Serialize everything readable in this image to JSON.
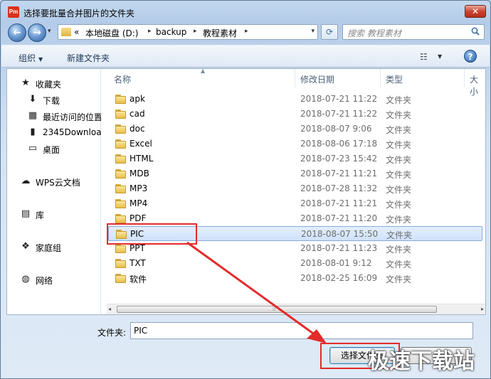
{
  "window": {
    "title": "选择要批量合并图片的文件夹",
    "app_icon_text": "Pm",
    "close_label": "✕"
  },
  "navbar": {
    "back_label": "←",
    "forward_label": "→",
    "history_arrow": "▾",
    "breadcrumb": {
      "overflow": "«",
      "segments": [
        "本地磁盘 (D:)",
        "backup",
        "教程素材"
      ],
      "separator": "▸",
      "dropdown": "▾"
    },
    "refresh_label": "⟳",
    "search_placeholder": "搜索 教程素材"
  },
  "toolbar": {
    "organize_label": "组织",
    "organize_drop": "▼",
    "new_folder_label": "新建文件夹",
    "view_icon": "☷",
    "view_drop": "▼",
    "help_label": "?"
  },
  "sidebar": {
    "items": [
      {
        "label": "收藏夹",
        "icon": "star-icon",
        "glyph": "★",
        "color": "#e8b21a"
      },
      {
        "label": "下载",
        "icon": "download-folder-icon",
        "glyph": "⬇",
        "color": "#3b78c4"
      },
      {
        "label": "最近访问的位置",
        "icon": "recent-places-icon",
        "glyph": "▦",
        "color": "#6b7d93"
      },
      {
        "label": "2345Downloads",
        "icon": "folder-icon",
        "glyph": "▮",
        "color": "#e1b545"
      },
      {
        "label": "桌面",
        "icon": "desktop-icon",
        "glyph": "▭",
        "color": "#2d6ab8"
      },
      {
        "label": "WPS云文档",
        "icon": "cloud-icon",
        "glyph": "☁",
        "color": "#3b7fd1"
      },
      {
        "label": "库",
        "icon": "library-icon",
        "glyph": "▤",
        "color": "#d9a93a"
      },
      {
        "label": "家庭组",
        "icon": "homegroup-icon",
        "glyph": "❖",
        "color": "#2f7fc7"
      },
      {
        "label": "网络",
        "icon": "network-icon",
        "glyph": "◍",
        "color": "#2f7fc7"
      }
    ]
  },
  "filelist": {
    "columns": [
      "名称",
      "修改日期",
      "类型",
      "大小"
    ],
    "sort_indicator": "▲",
    "rows": [
      {
        "name": "apk",
        "date": "2018-07-21 11:22",
        "type": "文件夹"
      },
      {
        "name": "cad",
        "date": "2018-07-21 11:22",
        "type": "文件夹"
      },
      {
        "name": "doc",
        "date": "2018-08-07 9:06",
        "type": "文件夹"
      },
      {
        "name": "Excel",
        "date": "2018-08-06 17:18",
        "type": "文件夹"
      },
      {
        "name": "HTML",
        "date": "2018-07-23 15:42",
        "type": "文件夹"
      },
      {
        "name": "MDB",
        "date": "2018-07-21 11:21",
        "type": "文件夹"
      },
      {
        "name": "MP3",
        "date": "2018-07-28 11:32",
        "type": "文件夹"
      },
      {
        "name": "MP4",
        "date": "2018-07-21 11:21",
        "type": "文件夹"
      },
      {
        "name": "PDF",
        "date": "2018-07-21 11:20",
        "type": "文件夹"
      },
      {
        "name": "PIC",
        "date": "2018-08-07 15:50",
        "type": "文件夹",
        "selected": true
      },
      {
        "name": "PPT",
        "date": "2018-07-21 11:23",
        "type": "文件夹"
      },
      {
        "name": "TXT",
        "date": "2018-08-01 9:12",
        "type": "文件夹"
      },
      {
        "name": "软件",
        "date": "2018-02-25 16:09",
        "type": "文件夹"
      }
    ],
    "scroll_left": "◂",
    "scroll_right": "▸",
    "scroll_grip": "⦙⦙⦙"
  },
  "footer": {
    "folder_label": "文件夹:",
    "folder_value": "PIC",
    "select_button_label": "选择文件夹"
  },
  "annotation": {
    "highlight_color": "#e32b2b"
  },
  "watermark": {
    "text": "极速下载站"
  }
}
